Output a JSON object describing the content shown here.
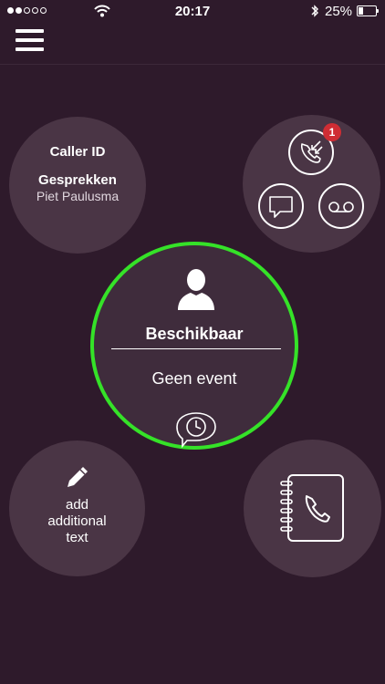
{
  "status_bar": {
    "time": "20:17",
    "battery": "25%",
    "signal_bars": 2,
    "signal_total": 5,
    "battery_level": 0.25
  },
  "menu": {
    "icon": "hamburger-menu-icon"
  },
  "caller_card": {
    "title": "Caller ID",
    "subtitle": "Gesprekken",
    "name": "Piet Paulusma"
  },
  "comms": {
    "missed_calls_badge": "1",
    "icons": [
      "missed-call-icon",
      "chat-icon",
      "voicemail-icon"
    ]
  },
  "status_card": {
    "state": "Beschikbaar",
    "event": "Geen event",
    "ring_color": "#35e228"
  },
  "add_text": {
    "label_line1": "add",
    "label_line2": "additional",
    "label_line3": "text"
  },
  "contacts": {
    "icon": "phonebook-icon"
  },
  "colors": {
    "background": "#2e1a2b",
    "circle": "#4a3545",
    "badge": "#cf2d34"
  }
}
